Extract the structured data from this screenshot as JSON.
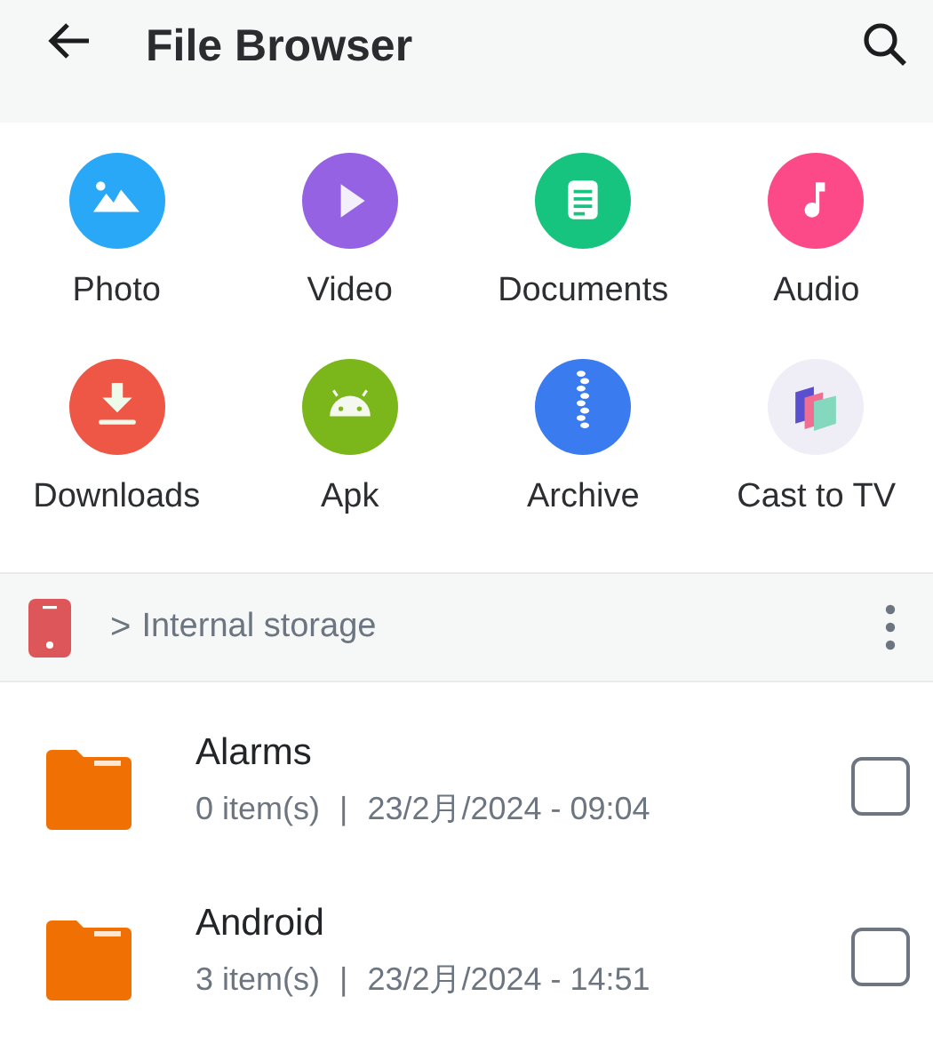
{
  "header": {
    "title": "File Browser"
  },
  "categories": [
    {
      "label": "Photo",
      "kind": "photo",
      "color": "#2aa8f8"
    },
    {
      "label": "Video",
      "kind": "video",
      "color": "#9462e3"
    },
    {
      "label": "Documents",
      "kind": "documents",
      "color": "#16c47f"
    },
    {
      "label": "Audio",
      "kind": "audio",
      "color": "#fb4a87"
    },
    {
      "label": "Downloads",
      "kind": "downloads",
      "color": "#ee5646"
    },
    {
      "label": "Apk",
      "kind": "apk",
      "color": "#7bb61b"
    },
    {
      "label": "Archive",
      "kind": "archive",
      "color": "#3a7bf0"
    },
    {
      "label": "Cast to TV",
      "kind": "cast",
      "color": "#efedf6"
    }
  ],
  "breadcrumb": {
    "separator": ">",
    "path": "Internal storage"
  },
  "files": [
    {
      "name": "Alarms",
      "count": "0 item(s)",
      "separator": "|",
      "date": "23/2月/2024 - 09:04",
      "checked": false
    },
    {
      "name": "Android",
      "count": "3 item(s)",
      "separator": "|",
      "date": "23/2月/2024 - 14:51",
      "checked": false
    }
  ]
}
